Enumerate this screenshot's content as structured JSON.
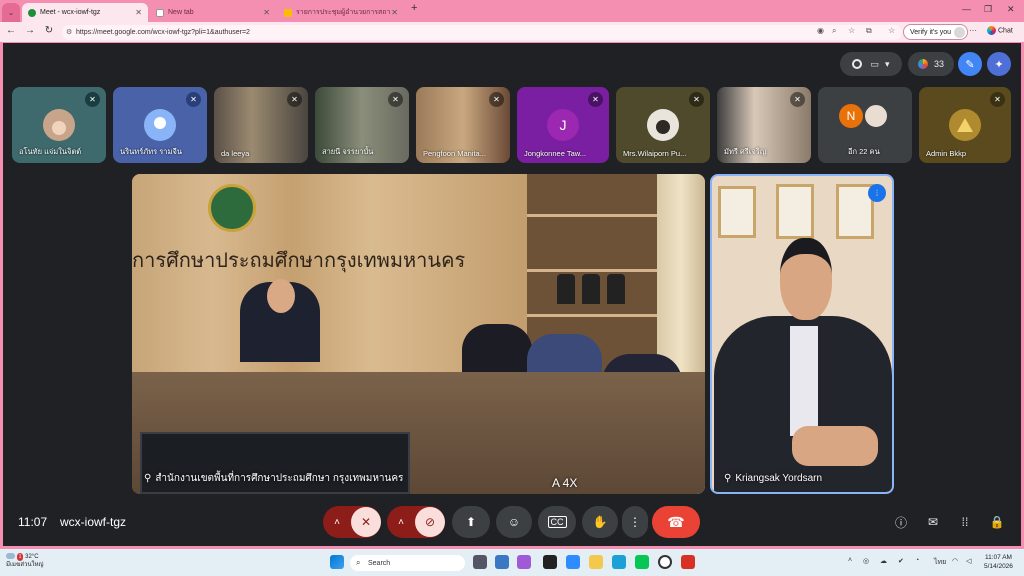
{
  "browser": {
    "tabs": [
      {
        "title": "Meet - wcx-iowf-tgz",
        "active": true
      },
      {
        "title": "New tab",
        "active": false
      },
      {
        "title": "รายการประชุมผู้อำนวยการสถานศึกษา",
        "active": false
      }
    ],
    "url": "https://meet.google.com/wcx-iowf-tgz?pli=1&authuser=2",
    "verify_label": "Verify it's you",
    "chat_label": "Chat"
  },
  "meet": {
    "participant_count": "33",
    "participants": [
      {
        "name": "อโนทัย แจ่มในจิตต์",
        "muted": true,
        "bg": "#3e6a6e"
      },
      {
        "name": "นรินทร์ภัทร รามจีน",
        "muted": true,
        "bg": "#4a63a8"
      },
      {
        "name": "da leeya",
        "muted": true,
        "bg": "#5b5048"
      },
      {
        "name": "สายนี จรรยาบั้น",
        "muted": true,
        "bg": "#6b6a60"
      },
      {
        "name": "Pengfoon Manita...",
        "muted": true,
        "bg": "#7a5a46"
      },
      {
        "name": "Jongkonnee Taw...",
        "muted": true,
        "bg": "#7b1fa2",
        "initial": "J"
      },
      {
        "name": "Mrs.Wilaiporn Pu...",
        "muted": true,
        "bg": "#4f4a2c"
      },
      {
        "name": "มัทรี ศรีเจริญ",
        "muted": true,
        "bg": "#8a7a6a"
      },
      {
        "name": "อีก 22 คน",
        "muted": false,
        "bg": "#3c4043",
        "initial": "N"
      },
      {
        "name": "Admin Bkkp",
        "muted": true,
        "bg": "#5a4a1e"
      }
    ],
    "main_speaker": "สำนักงานเขตพื้นที่การศึกษาประถมศึกษา กรุงเทพมหานคร",
    "main_wall_text": "การศึกษาประถมศึกษากรุงเทพมหานคร",
    "main_overlay_text": "A 4X",
    "side_speaker": "Kriangsak Yordsarn",
    "time": "11:07",
    "meeting_code": "wcx-iowf-tgz"
  },
  "taskbar": {
    "temperature": "32°C",
    "weather_text": "มีเมฆส่วนใหญ่",
    "search_placeholder": "Search",
    "language": "ไทย",
    "clock_time": "11:07 AM",
    "clock_date": "5/14/2026",
    "notification_count": "1"
  },
  "colors": {
    "accent": "#8ab4f8",
    "end_call": "#ea4335",
    "muted_button": "#f9dedc",
    "muted_button_bg": "#8c1d18"
  }
}
